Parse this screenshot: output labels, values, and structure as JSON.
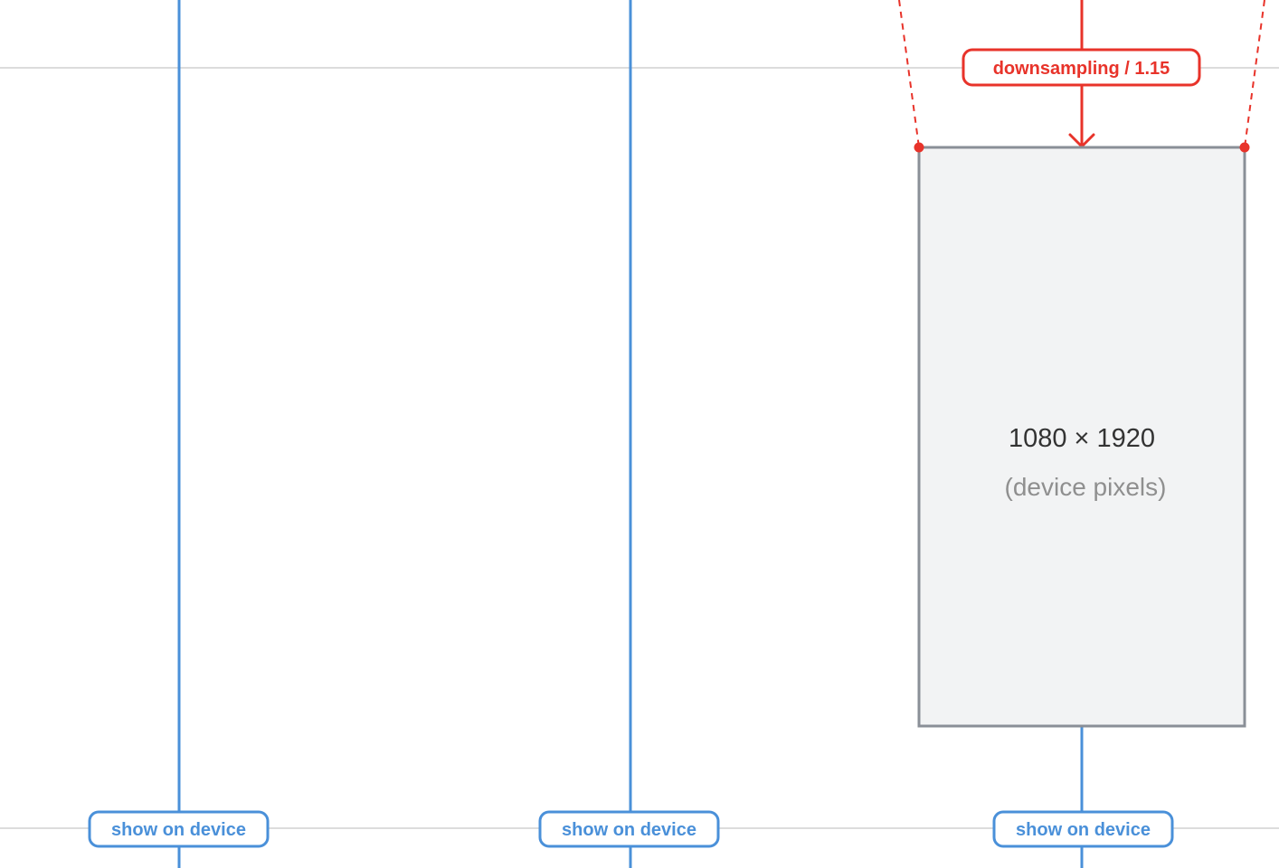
{
  "diagram": {
    "downsampling_label": "downsampling / 1.15",
    "device_size": "1080 × 1920",
    "device_unit": "(device pixels)",
    "buttons": [
      {
        "label": "show on device"
      },
      {
        "label": "show on device"
      },
      {
        "label": "show on device"
      }
    ]
  },
  "colors": {
    "blue": "#4a90d9",
    "red": "#e8332a",
    "gray_border": "#8a8f97",
    "device_fill": "#f2f3f4",
    "guide": "#dcdcdc"
  }
}
